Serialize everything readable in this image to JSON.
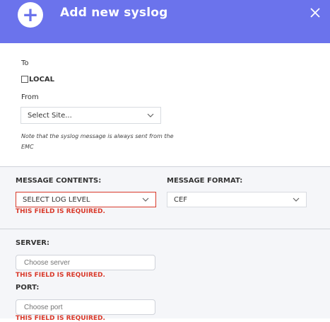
{
  "header": {
    "title": "Add new syslog",
    "plus_icon": "plus-icon",
    "close_icon": "close-icon",
    "color": "#6b73ec"
  },
  "to": {
    "label": "To",
    "local_label": "LOCAL",
    "local_checked": false
  },
  "from": {
    "label": "From",
    "value": "Select Site..."
  },
  "note": "Note that the syslog message is always sent from the EMC",
  "message_contents": {
    "label": "MESSAGE CONTENTS:",
    "value": "SELECT LOG LEVEL",
    "error": "THIS FIELD IS REQUIRED."
  },
  "message_format": {
    "label": "MESSAGE FORMAT:",
    "value": "CEF"
  },
  "server": {
    "label": "SERVER:",
    "placeholder": "Choose server",
    "error": "THIS FIELD IS REQUIRED."
  },
  "port": {
    "label": "PORT:",
    "placeholder": "Choose port",
    "error": "THIS FIELD IS REQUIRED."
  },
  "colors": {
    "error": "#d93a2b"
  }
}
